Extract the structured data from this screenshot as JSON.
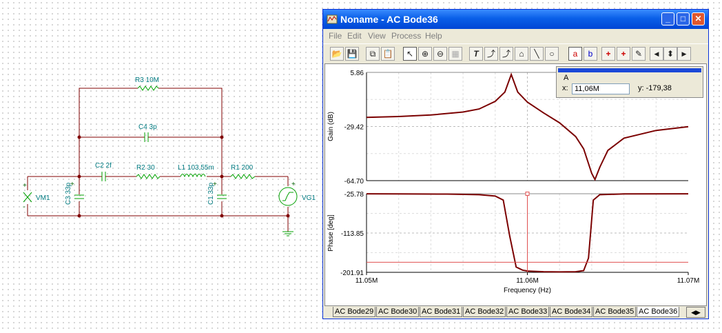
{
  "schematic": {
    "labels": {
      "r3": "R3 10M",
      "c4": "C4 3p",
      "c2": "C2 2f",
      "r2": "R2 30",
      "l1": "L1 103,55m",
      "r1": "R1 200",
      "c3": "C3 33p",
      "c1": "C1 33p",
      "vm1": "VM1",
      "vg1": "VG1"
    },
    "colors": {
      "wire": "#800000",
      "label": "#007a80",
      "component": "#00a000"
    }
  },
  "window": {
    "title": "Noname - AC Bode36",
    "controls": {
      "minimize": "_",
      "maximize": "□",
      "close": "✕"
    },
    "menu": [
      "File",
      "Edit",
      "View",
      "Process",
      "Help"
    ],
    "toolbar": [
      {
        "name": "open-folder-icon",
        "glyph": "📂"
      },
      {
        "name": "save-icon",
        "glyph": "💾"
      },
      {
        "name": "copy-icon",
        "glyph": "⧉"
      },
      {
        "name": "paste-icon",
        "glyph": "📋"
      },
      {
        "name": "pointer-icon",
        "glyph": "↖"
      },
      {
        "name": "zoom-in-icon",
        "glyph": "⊕"
      },
      {
        "name": "zoom-100-icon",
        "glyph": "⊖"
      },
      {
        "name": "grid-icon",
        "glyph": "▦"
      },
      {
        "name": "text-tool-icon",
        "glyph": "T"
      },
      {
        "name": "arrow-tool-icon",
        "glyph": "⤴"
      },
      {
        "name": "arrow-tool2-icon",
        "glyph": "⤴"
      },
      {
        "name": "label-tool-icon",
        "glyph": "⌂"
      },
      {
        "name": "line-tool-icon",
        "glyph": "╲"
      },
      {
        "name": "circle-tool-icon",
        "glyph": "○"
      },
      {
        "name": "cursor-a-icon",
        "glyph": "a"
      },
      {
        "name": "cursor-b-icon",
        "glyph": "b"
      },
      {
        "name": "add-marker-icon",
        "glyph": "+"
      },
      {
        "name": "add-marker2-icon",
        "glyph": "+"
      },
      {
        "name": "probe-icon",
        "glyph": "✎"
      },
      {
        "name": "nav-left-icon",
        "glyph": "◀"
      },
      {
        "name": "nav-updown-icon",
        "glyph": "⬍"
      },
      {
        "name": "nav-right-icon",
        "glyph": "▶"
      }
    ]
  },
  "cursor_panel": {
    "name": "A",
    "x_label": "x:",
    "x_value": "11,06M",
    "y_text": "y: -179,38"
  },
  "tabs": [
    "AC Bode29",
    "AC Bode30",
    "AC Bode31",
    "AC Bode32",
    "AC Bode33",
    "AC Bode34",
    "AC Bode35",
    "AC Bode36"
  ],
  "active_tab": "AC Bode36",
  "chart_data": [
    {
      "type": "line",
      "title": "",
      "xlabel": "",
      "ylabel": "Gain (dB)",
      "xlim": [
        11050000,
        11070000
      ],
      "ylim": [
        -64.7,
        5.86
      ],
      "yticks": [
        "5.86",
        "-29.42",
        "-64.70"
      ],
      "grid": true,
      "color": "#7b0000",
      "series": [
        {
          "x": [
            11050000,
            11052000,
            11054000,
            11056000,
            11057000,
            11058000,
            11058600,
            11059000,
            11059400,
            11060000,
            11061000,
            11062000,
            11063000,
            11063500,
            11064000,
            11064200,
            11064500,
            11065000,
            11066000,
            11068000,
            11070000
          ],
          "y": [
            -23.5,
            -22.9,
            -21.9,
            -20.0,
            -18.0,
            -13.0,
            -7.0,
            4.5,
            -7.0,
            -13.5,
            -20.5,
            -27.0,
            -36.0,
            -44.0,
            -60.0,
            -64.0,
            -56.0,
            -45.0,
            -37.0,
            -32.0,
            -29.5
          ]
        }
      ]
    },
    {
      "type": "line",
      "title": "",
      "xlabel": "Frequency (Hz)",
      "ylabel": "Phase [deg]",
      "xlim": [
        11050000,
        11070000
      ],
      "ylim": [
        -201.91,
        -25.78
      ],
      "yticks": [
        "-25.78",
        "-113.85",
        "-201.91"
      ],
      "xticks": [
        "11.05M",
        "11.06M",
        "11.07M"
      ],
      "grid": true,
      "color": "#7b0000",
      "cursor": {
        "x": 11060000,
        "y": -179.38
      },
      "series": [
        {
          "x": [
            11050000,
            11052000,
            11055000,
            11057000,
            11058000,
            11058500,
            11058900,
            11059300,
            11059700,
            11060000,
            11061000,
            11062000,
            11063000,
            11063500,
            11063800,
            11064100,
            11064500,
            11066000,
            11070000
          ],
          "y": [
            -25.9,
            -26.1,
            -26.5,
            -28.0,
            -31.0,
            -40.0,
            -120.0,
            -190.0,
            -197.0,
            -199.0,
            -200.5,
            -201.0,
            -200.5,
            -198.0,
            -170.0,
            -40.0,
            -28.0,
            -26.3,
            -25.9
          ]
        }
      ]
    }
  ]
}
